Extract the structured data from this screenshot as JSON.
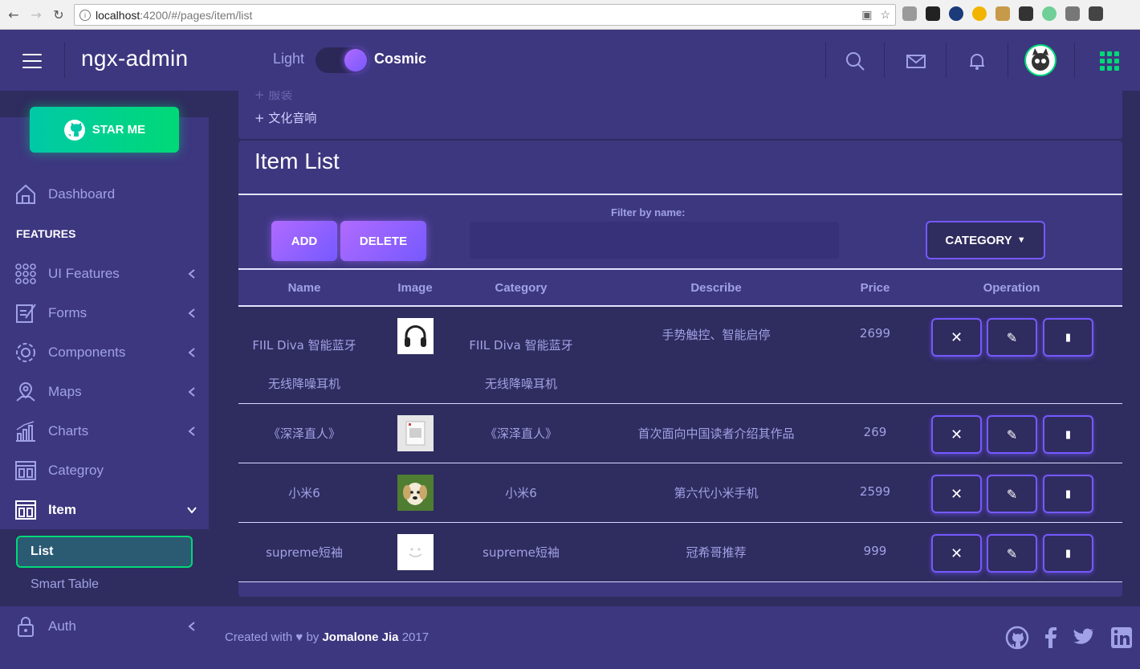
{
  "browser": {
    "host": "localhost",
    "path": ":4200/#/pages/item/list"
  },
  "header": {
    "brand": "ngx-admin",
    "theme_light": "Light",
    "theme_cosmic": "Cosmic"
  },
  "sidebar": {
    "star_button": "STAR ME",
    "dashboard": "Dashboard",
    "features_heading": "FEATURES",
    "items": [
      {
        "label": "UI Features"
      },
      {
        "label": "Forms"
      },
      {
        "label": "Components"
      },
      {
        "label": "Maps"
      },
      {
        "label": "Charts"
      },
      {
        "label": "Categroy"
      },
      {
        "label": "Item"
      },
      {
        "label": "Auth"
      }
    ],
    "submenu": {
      "active": "List",
      "other": "Smart Table"
    }
  },
  "category_card": {
    "faded": "+ 服装",
    "item": "+ 文化音响"
  },
  "item_list": {
    "title": "Item List",
    "add_label": "ADD",
    "delete_label": "DELETE",
    "filter_label": "Filter by name:",
    "filter_value": "",
    "category_label": "CATEGORY",
    "columns": [
      "Name",
      "Image",
      "Category",
      "Describe",
      "Price",
      "Operation"
    ],
    "rows": [
      {
        "name": "FIIL Diva 智能蓝牙\n无线降噪耳机",
        "category": "FIIL Diva 智能蓝牙\n无线降噪耳机",
        "describe": "手势触控、智能启停",
        "price": "2699"
      },
      {
        "name": "《深泽直人》",
        "category": "《深泽直人》",
        "describe": "首次面向中国读者介绍其作品",
        "price": "269"
      },
      {
        "name": "小米6",
        "category": "小米6",
        "describe": "第六代小米手机",
        "price": "2599"
      },
      {
        "name": "supreme短袖",
        "category": "supreme短袖",
        "describe": "冠希哥推荐",
        "price": "999"
      }
    ]
  },
  "footer": {
    "prefix": "Created with ♥ by",
    "author": "Jomalone Jia",
    "year": "2017"
  },
  "colors": {
    "accent": "#7659ff",
    "success": "#00d977",
    "header_bg": "#3d3780",
    "page_bg": "#2f2c5f"
  }
}
